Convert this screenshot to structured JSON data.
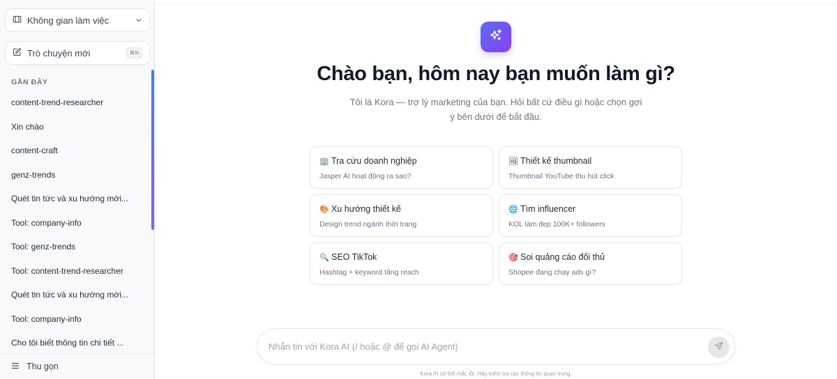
{
  "sidebar": {
    "workspace_label": "Không gian làm việc",
    "new_chat_label": "Trò chuyện mới",
    "new_chat_shortcut": "⌘N",
    "recent_title": "GẦN ĐÂY",
    "recent_items": [
      "content-trend-researcher",
      "Xin chào",
      "content-craft",
      "genz-trends",
      "Quét tin tức và xu hướng mới...",
      "Tool: company-info",
      "Tool: genz-trends",
      "Tool: content-trend-researcher",
      "Quét tin tức và xu hướng mới...",
      "Tool: company-info",
      "Cho tôi biết thông tin chi tiết ..."
    ],
    "collapse_label": "Thu gọn"
  },
  "main": {
    "headline": "Chào bạn, hôm nay bạn muốn làm gì?",
    "subtitle": "Tôi là Kora — trợ lý marketing của bạn. Hỏi bất cứ điều gì hoặc chọn gợi ý bên dưới để bắt đầu.",
    "cards": [
      {
        "emoji": "🏢",
        "title": "Tra cứu doanh nghiệp",
        "desc": "Jasper AI hoạt động ra sao?"
      },
      {
        "emoji": "🖼",
        "title": "Thiết kế thumbnail",
        "desc": "Thumbnail YouTube thu hút click"
      },
      {
        "emoji": "🎨",
        "title": "Xu hướng thiết kế",
        "desc": "Design trend ngành thời trang"
      },
      {
        "emoji": "🌐",
        "title": "Tìm influencer",
        "desc": "KOL làm đẹp 100K+ followers"
      },
      {
        "emoji": "🔍",
        "title": "SEO TikTok",
        "desc": "Hashtag + keyword tăng reach"
      },
      {
        "emoji": "🎯",
        "title": "Soi quảng cáo đối thủ",
        "desc": "Shopee đang chạy ads gì?"
      }
    ],
    "composer_placeholder": "Nhắn tin với Kora AI (/ hoặc @ để gọi AI Agent)",
    "disclaimer": "Kora AI có thể mắc lỗi. Hãy kiểm tra các thông tin quan trọng."
  },
  "colors": {
    "accent_start": "#5b6cf6",
    "accent_end": "#8b3ff0"
  }
}
